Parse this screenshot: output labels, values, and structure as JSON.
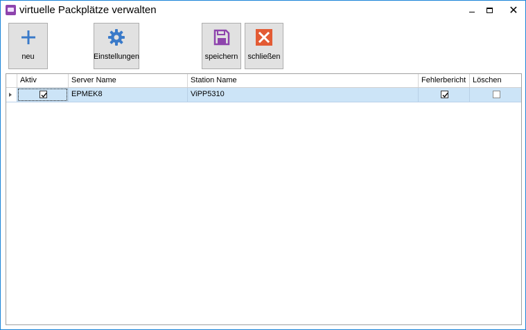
{
  "window": {
    "title": "virtuelle Packplätze verwalten"
  },
  "toolbar": {
    "buttons": [
      {
        "id": "neu",
        "label": "neu",
        "icon": "plus-icon",
        "color": "#3a7ac9"
      },
      {
        "id": "einstellungen",
        "label": "Einstellungen",
        "icon": "gear-icon",
        "color": "#3a7ac9"
      },
      {
        "id": "speichern",
        "label": "speichern",
        "icon": "floppy-disk-icon",
        "color": "#8e44ad"
      },
      {
        "id": "schliessen",
        "label": "schließen",
        "icon": "close-x-icon",
        "color": "#e35b34"
      }
    ]
  },
  "grid": {
    "columns": [
      {
        "key": "aktiv",
        "label": "Aktiv"
      },
      {
        "key": "server",
        "label": "Server Name"
      },
      {
        "key": "station",
        "label": "Station Name"
      },
      {
        "key": "fehler",
        "label": "Fehlerbericht"
      },
      {
        "key": "loeschen",
        "label": "Löschen"
      }
    ],
    "rows": [
      {
        "aktiv": true,
        "server": "EPMEK8",
        "station": "ViPP5310",
        "fehler": true,
        "loeschen": false
      }
    ],
    "selected_row_color": "#cce4f7"
  }
}
